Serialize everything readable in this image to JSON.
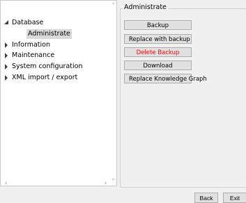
{
  "tree": {
    "items": [
      {
        "label": "Database",
        "expanded": true
      },
      {
        "label": "Administrate",
        "selected": true
      },
      {
        "label": "Information",
        "expanded": false
      },
      {
        "label": "Maintenance",
        "expanded": false
      },
      {
        "label": "System configuration",
        "expanded": false
      },
      {
        "label": "XML import / export",
        "expanded": false
      }
    ]
  },
  "panel": {
    "title": "Administrate",
    "buttons": {
      "backup": "Backup",
      "replace_with_backup": "Replace with backup",
      "delete_backup": "Delete Backup",
      "download": "Download",
      "replace_knowledge_graph": "Replace Knowledge Graph"
    }
  },
  "footer": {
    "back": "Back",
    "exit": "Exit"
  },
  "colors": {
    "danger_text": "#ff0000",
    "selection_bg": "#d9d9d9"
  },
  "icons": {
    "expanded": "triangle-down-right-icon",
    "collapsed": "triangle-right-icon"
  }
}
